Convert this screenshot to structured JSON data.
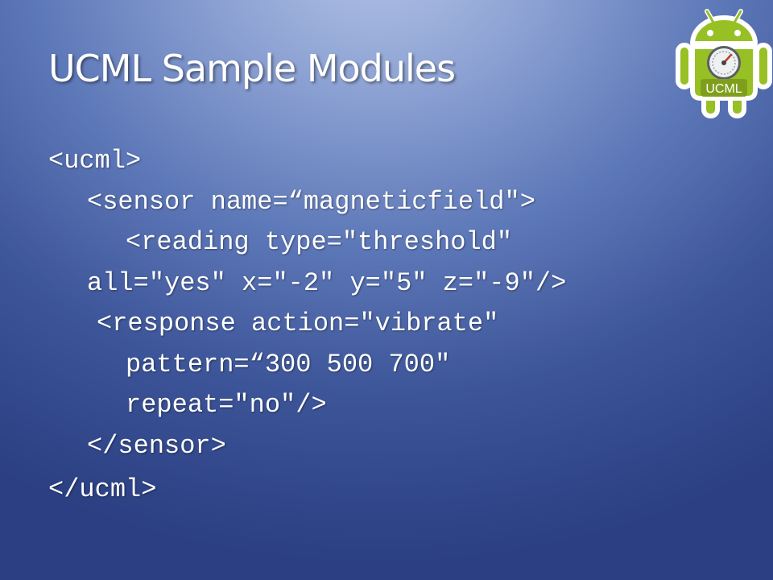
{
  "slide": {
    "title": "UCML Sample Modules"
  },
  "logo": {
    "label": "UCML",
    "icon": "android-gauge-icon",
    "colors": {
      "body": "#97c024",
      "outline": "#ffffff",
      "gauge": "#d9dde2",
      "badge": "#7f9f1c"
    }
  },
  "code": {
    "lines": [
      "<ucml>",
      "<sensor name=“magneticfield\">",
      "<reading type=\"threshold\"",
      "all=\"yes\" x=\"-2\" y=\"5\" z=\"-9\"/>",
      "<response action=\"vibrate\"",
      "pattern=“300 500 700\"",
      "repeat=\"no\"/>",
      "</sensor>",
      "</ucml>"
    ]
  }
}
